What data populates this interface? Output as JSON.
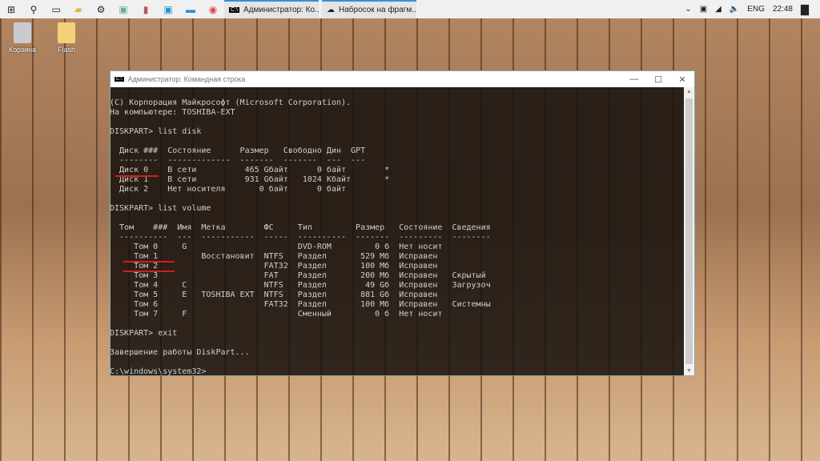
{
  "taskbar": {
    "tasks": [
      {
        "label": "Администратор: Ко..."
      },
      {
        "label": "Набросок на фрагм..."
      }
    ],
    "tray": {
      "language": "ENG",
      "time": "22:48"
    }
  },
  "desktop": {
    "icons": [
      {
        "label": "Корзина"
      },
      {
        "label": "Flash"
      }
    ]
  },
  "console": {
    "title": "Администратор: Командная строка",
    "lines": [
      "(C) Корпорация Майкрософт (Microsoft Corporation).",
      "На компьютере: TOSHIBA-EXT",
      "",
      "DISKPART> list disk",
      "",
      "  Диск ###  Состояние      Размер   Свободно Дин  GPT",
      "  --------  -------------  -------  -------  ---  ---",
      "  Диск 0    В сети          465 Gбайт      0 байт        *",
      "  Диск 1    В сети          931 Gбайт   1024 Kбайт       *",
      "  Диск 2    Нет носителя       0 байт      0 байт",
      "",
      "DISKPART> list volume",
      "",
      "  Том    ###  Имя  Метка        ФС     Тип         Размер   Состояние  Сведения",
      "  ----------  ---  -----------  -----  ----------  -------  ---------  --------",
      "     Том 0     G                       DVD-ROM         0 б  Нет носит",
      "     Том 1         Восстановит  NTFS   Раздел       529 Мб  Исправен",
      "     Том 2                      FAT32  Раздел       100 Мб  Исправен",
      "     Том 3                      FAT    Раздел       200 Мб  Исправен   Скрытый",
      "     Том 4     C                NTFS   Раздел        49 Gб  Исправен   Загрузоч",
      "     Том 5     E   TOSHIBA EXT  NTFS   Раздел       881 Gб  Исправен",
      "     Том 6                      FAT32  Раздел       100 Мб  Исправен   Системны",
      "     Том 7     F                       Сменный         0 б  Нет носит",
      "",
      "DISKPART> exit",
      "",
      "Завершение работы DiskPart...",
      "",
      "C:\\windows\\system32>"
    ]
  },
  "colors": {
    "underline": "#d0201c",
    "taskbar_accent": "#3c8fd0"
  }
}
